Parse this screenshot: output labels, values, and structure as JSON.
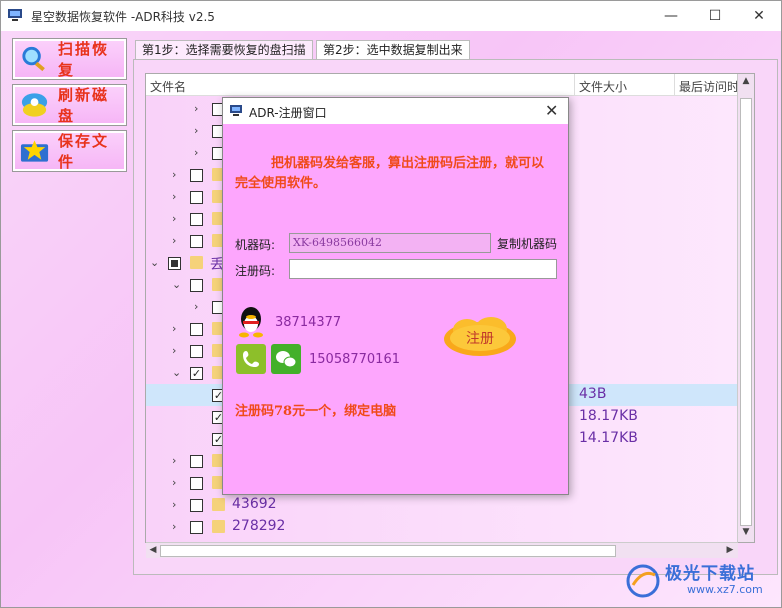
{
  "window": {
    "title": "星空数据恢复软件   -ADR科技 v2.5"
  },
  "sidebar": [
    {
      "name": "scan-recover-button",
      "label": "扫描恢复"
    },
    {
      "name": "refresh-disk-button",
      "label": "刷新磁盘"
    },
    {
      "name": "save-file-button",
      "label": "保存文件"
    }
  ],
  "tabs": [
    {
      "label": "第1步：选择需要恢复的盘扫描"
    },
    {
      "label": "第2步：选中数据复制出来"
    }
  ],
  "table": {
    "columns": [
      "文件名",
      "文件大小",
      "最后访问时"
    ],
    "rows": [
      {
        "expand": ">",
        "check": "none",
        "name": "",
        "size": "",
        "level": 2
      },
      {
        "expand": ">",
        "check": "none",
        "name": "",
        "size": "",
        "level": 2
      },
      {
        "expand": ">",
        "check": "none",
        "name": "",
        "size": "",
        "level": 2
      },
      {
        "expand": ">",
        "check": "none",
        "name": "",
        "size": "",
        "level": 1
      },
      {
        "expand": ">",
        "check": "none",
        "name": "",
        "size": "",
        "level": 1
      },
      {
        "expand": ">",
        "check": "none",
        "name": "",
        "size": "",
        "level": 1
      },
      {
        "expand": ">",
        "check": "none",
        "name": "",
        "size": "",
        "level": 1
      },
      {
        "expand": "v",
        "check": "partial",
        "name": "丢",
        "size": "",
        "level": 0
      },
      {
        "expand": "v",
        "check": "none",
        "name": "",
        "size": "",
        "level": 1
      },
      {
        "expand": ">",
        "check": "none",
        "name": "",
        "size": "",
        "level": 2
      },
      {
        "expand": ">",
        "check": "none",
        "name": "",
        "size": "",
        "level": 1
      },
      {
        "expand": ">",
        "check": "none",
        "name": "",
        "size": "",
        "level": 1
      },
      {
        "expand": "v",
        "check": "checked",
        "name": "",
        "size": "",
        "level": 1
      },
      {
        "expand": "",
        "check": "checked",
        "name": "",
        "size": "43B",
        "level": 2,
        "selected": true
      },
      {
        "expand": "",
        "check": "checked",
        "name": "",
        "size": "18.17KB",
        "level": 2
      },
      {
        "expand": "",
        "check": "checked",
        "name": "",
        "size": "14.17KB",
        "level": 2
      },
      {
        "expand": ">",
        "check": "none",
        "name": "",
        "size": "",
        "level": 1
      },
      {
        "expand": ">",
        "check": "none",
        "name": "",
        "size": "",
        "level": 1
      },
      {
        "expand": ">",
        "check": "none",
        "name": "43692",
        "size": "",
        "level": 1
      },
      {
        "expand": ">",
        "check": "none",
        "name": "278292",
        "size": "",
        "level": 1
      }
    ]
  },
  "dialog": {
    "title": "ADR-注册窗口",
    "notice": "把机器码发给客服，算出注册码后注册，就可以完全使用软件。",
    "machine_code_label": "机器码:",
    "machine_code_value": "XK-6498566042",
    "copy_label": "复制机器码",
    "reg_code_label": "注册码:",
    "reg_code_value": "",
    "qq_number": "38714377",
    "phone_number": "15058770161",
    "register_label": "注册",
    "price_text": "注册码78元一个，绑定电脑"
  },
  "watermark": {
    "title": "极光下载站",
    "url": "www.xz7.com"
  },
  "colors": {
    "accent": "#f04a1a",
    "background": "#f9d2f9",
    "dialog": "#fda6fd"
  }
}
